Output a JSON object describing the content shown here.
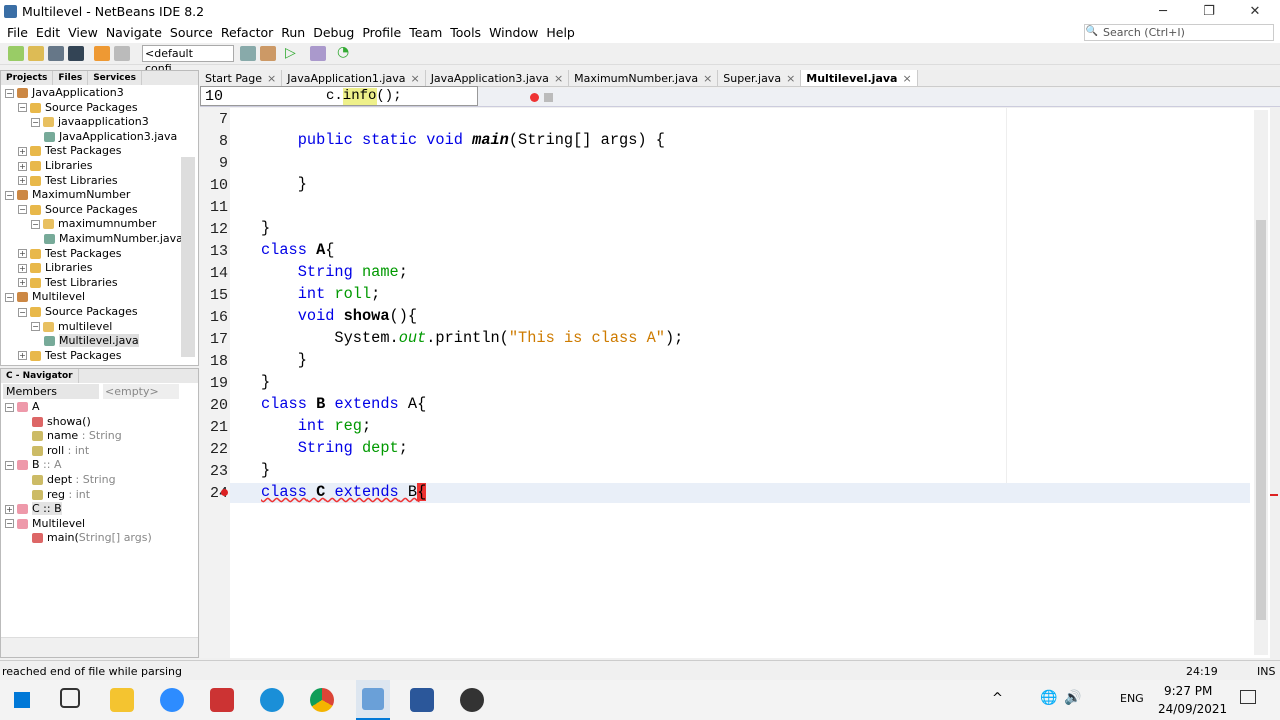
{
  "window": {
    "title": "Multilevel - NetBeans IDE 8.2",
    "minimize": "─",
    "restore": "❐",
    "close": "✕"
  },
  "menu": [
    "File",
    "Edit",
    "View",
    "Navigate",
    "Source",
    "Refactor",
    "Run",
    "Debug",
    "Profile",
    "Team",
    "Tools",
    "Window",
    "Help"
  ],
  "search": {
    "placeholder": "Search (Ctrl+I)"
  },
  "toolbar": {
    "config": "<default confi..."
  },
  "projects": {
    "tabs": [
      "Projects",
      "Files",
      "Services"
    ],
    "items": [
      {
        "label": "JavaApplication3",
        "level": 0,
        "icon": "project"
      },
      {
        "label": "Source Packages",
        "level": 1,
        "icon": "folder"
      },
      {
        "label": "javaapplication3",
        "level": 2,
        "icon": "package"
      },
      {
        "label": "JavaApplication3.java",
        "level": 3,
        "icon": "java-file"
      },
      {
        "label": "Test Packages",
        "level": 1,
        "icon": "folder"
      },
      {
        "label": "Libraries",
        "level": 1,
        "icon": "folder"
      },
      {
        "label": "Test Libraries",
        "level": 1,
        "icon": "folder"
      },
      {
        "label": "MaximumNumber",
        "level": 0,
        "icon": "project"
      },
      {
        "label": "Source Packages",
        "level": 1,
        "icon": "folder"
      },
      {
        "label": "maximumnumber",
        "level": 2,
        "icon": "package"
      },
      {
        "label": "MaximumNumber.java",
        "level": 3,
        "icon": "java-file"
      },
      {
        "label": "Test Packages",
        "level": 1,
        "icon": "folder"
      },
      {
        "label": "Libraries",
        "level": 1,
        "icon": "folder"
      },
      {
        "label": "Test Libraries",
        "level": 1,
        "icon": "folder"
      },
      {
        "label": "Multilevel",
        "level": 0,
        "icon": "project"
      },
      {
        "label": "Source Packages",
        "level": 1,
        "icon": "folder"
      },
      {
        "label": "multilevel",
        "level": 2,
        "icon": "package"
      },
      {
        "label": "Multilevel.java",
        "level": 3,
        "icon": "java-file",
        "selected": true
      },
      {
        "label": "Test Packages",
        "level": 1,
        "icon": "folder"
      }
    ]
  },
  "navigator": {
    "title": "C - Navigator",
    "filter": "Members",
    "empty": "<empty>",
    "items": [
      {
        "name": "A",
        "type": "",
        "level": 0
      },
      {
        "name": "showa()",
        "type": "",
        "level": 1
      },
      {
        "name": "name",
        "type": " : String",
        "level": 1
      },
      {
        "name": "roll",
        "type": " : int",
        "level": 1
      },
      {
        "name": "B",
        "type": " :: A",
        "level": 0
      },
      {
        "name": "dept",
        "type": " : String",
        "level": 1
      },
      {
        "name": "reg",
        "type": " : int",
        "level": 1
      },
      {
        "name": "C :: B",
        "type": "",
        "level": 0,
        "selected": true
      },
      {
        "name": "Multilevel",
        "type": "",
        "level": 0
      },
      {
        "name": "main(",
        "type": "String[] args)",
        "level": 1
      }
    ]
  },
  "editor": {
    "tabs": [
      "Start Page",
      "JavaApplication1.java",
      "JavaApplication3.java",
      "MaximumNumber.java",
      "Super.java",
      "Multilevel.java"
    ],
    "sticky": {
      "line": "10",
      "code": "c.info();"
    },
    "lines": [
      "7",
      "8",
      "9",
      "10",
      "11",
      "12",
      "13",
      "14",
      "15",
      "16",
      "17",
      "18",
      "19",
      "20",
      "21",
      "22",
      "23",
      "24"
    ]
  },
  "status": {
    "message": "reached end of file while parsing",
    "position": "24:19",
    "mode": "INS"
  },
  "taskbar": {
    "time": "9:27 PM",
    "date": "24/09/2021",
    "lang": "ENG"
  }
}
